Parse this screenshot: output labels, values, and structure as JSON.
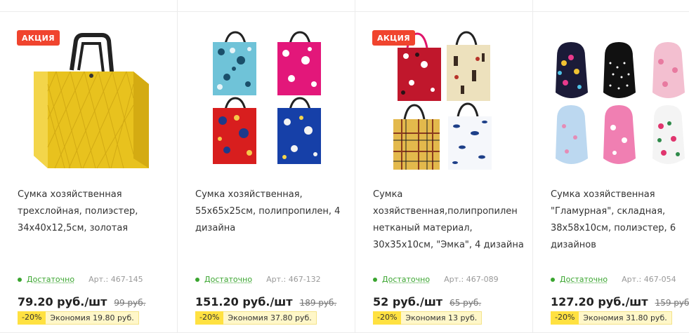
{
  "products": [
    {
      "badge": "АКЦИЯ",
      "title": "Сумка хозяйственная трехслойная, полиэстер, 34x40x12,5см, золотая",
      "stock": "Достаточно",
      "article": "Арт.: 467-145",
      "price": "79.20 руб./шт",
      "old_price": "99 руб.",
      "discount": "-20%",
      "saving": "Экономия 19.80 руб."
    },
    {
      "badge": "",
      "title": "Сумка хозяйственная, 55x65x25см, полипропилен, 4 дизайна",
      "stock": "Достаточно",
      "article": "Арт.: 467-132",
      "price": "151.20 руб./шт",
      "old_price": "189 руб.",
      "discount": "-20%",
      "saving": "Экономия 37.80 руб."
    },
    {
      "badge": "АКЦИЯ",
      "title": "Сумка хозяйственная,полипропилен нетканый материал, 30x35x10см, \"Эмка\", 4 дизайна",
      "stock": "Достаточно",
      "article": "Арт.: 467-089",
      "price": "52 руб./шт",
      "old_price": "65 руб.",
      "discount": "-20%",
      "saving": "Экономия 13 руб."
    },
    {
      "badge": "",
      "title": "Сумка хозяйственная \"Гламурная\", складная, 38x58x10см, полиэстер, 6 дизайнов",
      "stock": "Достаточно",
      "article": "Арт.: 467-054",
      "price": "127.20 руб./шт",
      "old_price": "159 руб.",
      "discount": "-20%",
      "saving": "Экономия 31.80 руб."
    }
  ],
  "colors": {
    "badge": "#f0442e",
    "stock": "#3aa52f",
    "discount": "#ffe141"
  }
}
